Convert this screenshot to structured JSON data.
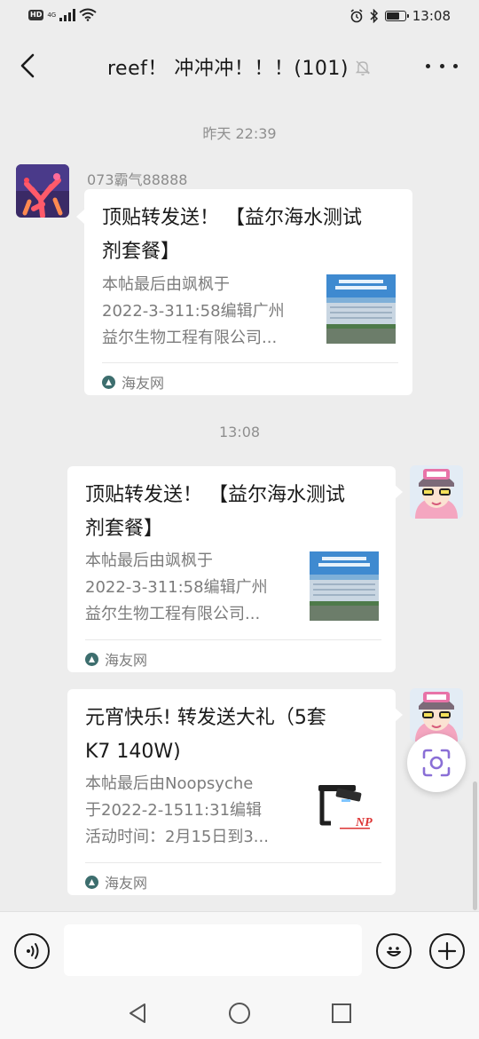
{
  "status_bar": {
    "hd_label": "HD",
    "signal_label": "4G",
    "time": "13:08"
  },
  "header": {
    "title": "reef！ 冲冲冲！！！(101)",
    "back_icon": "chevron-left-icon",
    "mute_icon": "bell-off-icon",
    "more_icon": "more-dots-icon"
  },
  "messages": {
    "timestamp_1": "昨天 22:39",
    "msg1": {
      "sender": "073霸气88888",
      "title_line1": "顶贴转发送！ 【益尔海水测试",
      "title_line2": "剂套餐】",
      "desc_line1": "本帖最后由飒枫于",
      "desc_line2": "2022-3-311:58编辑广州",
      "desc_line3": "益尔生物工程有限公司...",
      "source": "海友网"
    },
    "timestamp_2": "13:08",
    "msg2": {
      "title_line1": "顶贴转发送！ 【益尔海水测试",
      "title_line2": "剂套餐】",
      "desc_line1": "本帖最后由飒枫于",
      "desc_line2": "2022-3-311:58编辑广州",
      "desc_line3": "益尔生物工程有限公司...",
      "source": "海友网"
    },
    "msg3": {
      "title_line1": "元宵快乐! 转发送大礼（5套",
      "title_line2": "K7  140W)",
      "desc_line1": "本帖最后由Noopsyche",
      "desc_line2": "于2022-2-1511:31编辑",
      "desc_line3": "活动时间：2月15日到3...",
      "source": "海友网"
    }
  },
  "input_bar": {
    "placeholder": "",
    "value": ""
  },
  "colors": {
    "background": "#ededed",
    "card": "#ffffff",
    "accent_icon": "#8a6fd6"
  }
}
